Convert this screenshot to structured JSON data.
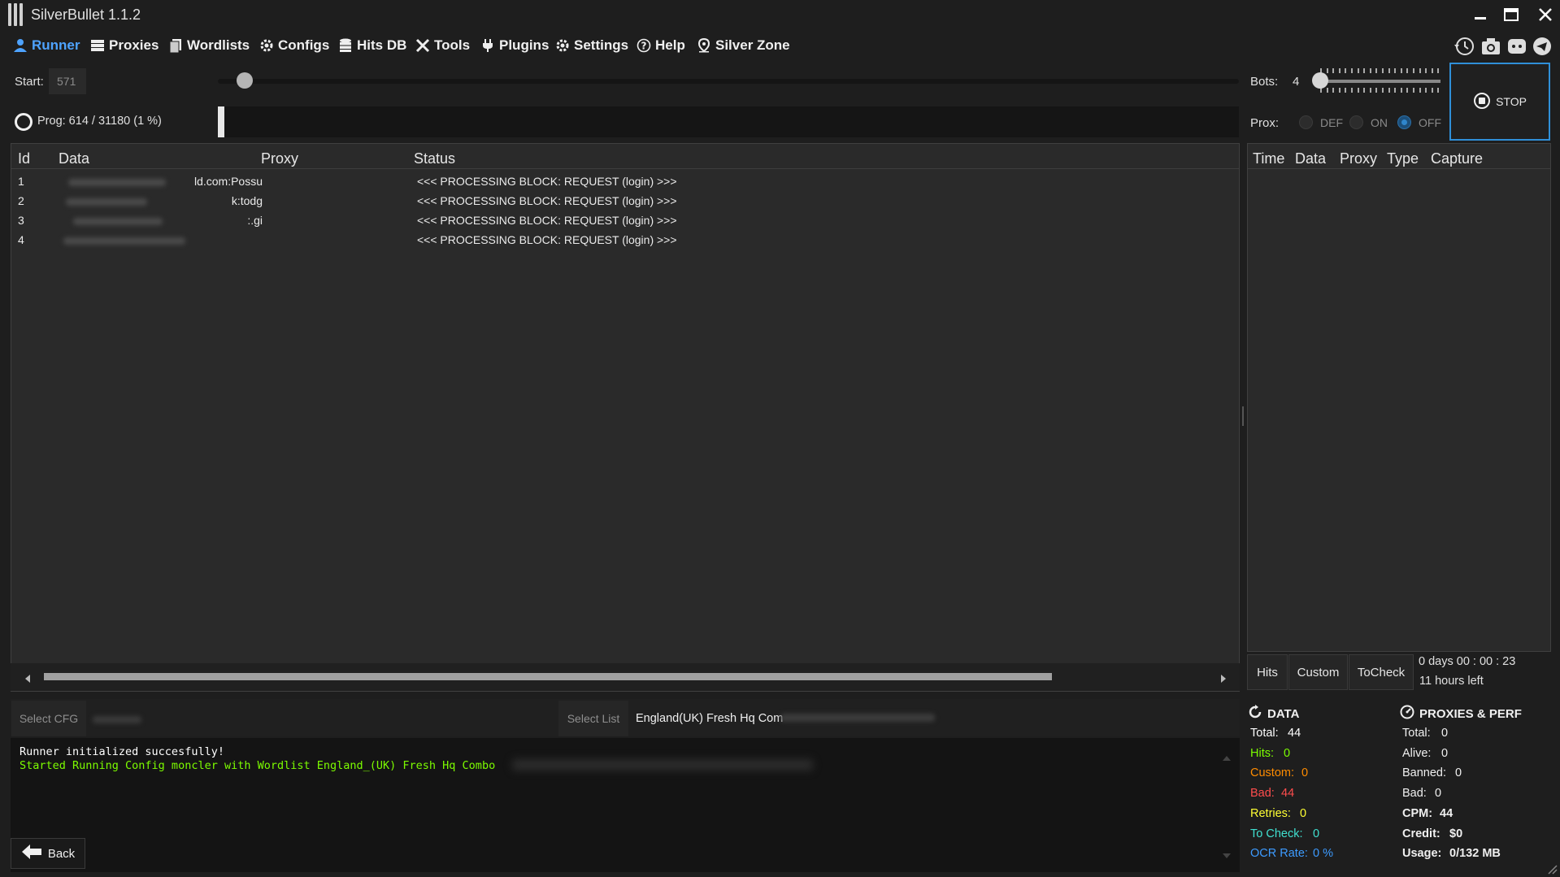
{
  "app": {
    "title": "SilverBullet 1.1.2"
  },
  "nav": {
    "items": [
      {
        "label": "Runner",
        "icon": "user-icon"
      },
      {
        "label": "Proxies",
        "icon": "server-icon"
      },
      {
        "label": "Wordlists",
        "icon": "documents-icon"
      },
      {
        "label": "Configs",
        "icon": "gear-icon"
      },
      {
        "label": "Hits DB",
        "icon": "database-icon"
      },
      {
        "label": "Tools",
        "icon": "tools-icon"
      },
      {
        "label": "Plugins",
        "icon": "plug-icon"
      },
      {
        "label": "Settings",
        "icon": "gear-icon"
      },
      {
        "label": "Help",
        "icon": "question-icon"
      },
      {
        "label": "Silver Zone",
        "icon": "pin-icon"
      }
    ]
  },
  "controls": {
    "start_label": "Start:",
    "start_value": "571",
    "prog_text": "Prog: 614 / 31180  (1 %)",
    "progress_fraction": 0.0197,
    "bots_label": "Bots:",
    "bots_value": "4",
    "prox_label": "Prox:",
    "prox_options": [
      "DEF",
      "ON",
      "OFF"
    ],
    "prox_selected": "OFF",
    "stop_label": "STOP"
  },
  "main_table": {
    "headers": [
      "Id",
      "Data",
      "Proxy",
      "Status"
    ],
    "rows": [
      {
        "id": "1",
        "data": "ld.com:Possu",
        "proxy": "",
        "status": "<<< PROCESSING BLOCK: REQUEST (login) >>>"
      },
      {
        "id": "2",
        "data": "k:todg",
        "proxy": "",
        "status": "<<< PROCESSING BLOCK: REQUEST (login) >>>"
      },
      {
        "id": "3",
        "data": ":.gi",
        "proxy": "",
        "status": "<<< PROCESSING BLOCK: REQUEST (login) >>>"
      },
      {
        "id": "4",
        "data": "",
        "proxy": "",
        "status": "<<< PROCESSING BLOCK: REQUEST (login) >>>"
      }
    ]
  },
  "hits_table": {
    "headers": [
      "Time",
      "Data",
      "Proxy",
      "Type",
      "Capture"
    ]
  },
  "tabs": [
    "Hits",
    "Custom",
    "ToCheck"
  ],
  "timer": {
    "elapsed": "0  days  00 : 00 : 23",
    "remaining": "11 hours left"
  },
  "bottom": {
    "select_cfg_label": "Select CFG",
    "select_list_label": "Select List",
    "wordlist_name": "England(UK) Fresh Hq Com",
    "log": [
      {
        "text": "Runner initialized succesfully!",
        "color": "#ffffff"
      },
      {
        "text": "Started Running Config moncler with Wordlist England_(UK) Fresh Hq Combo",
        "color": "#7cfc00"
      }
    ],
    "back_label": "Back"
  },
  "data_stats": {
    "title": "DATA",
    "items": [
      {
        "label": "Total:",
        "value": "44",
        "color": "#ffffff"
      },
      {
        "label": "Hits:",
        "value": "0",
        "color": "#7cfc00"
      },
      {
        "label": "Custom:",
        "value": "0",
        "color": "#ff8c00"
      },
      {
        "label": "Bad:",
        "value": "44",
        "color": "#ff4d4d"
      },
      {
        "label": "Retries:",
        "value": "0",
        "color": "#ffff33"
      },
      {
        "label": "To Check:",
        "value": "0",
        "color": "#40e0d0"
      },
      {
        "label": "OCR Rate:",
        "value": "0 %",
        "color": "#3d9bff"
      }
    ]
  },
  "proxy_stats": {
    "title": "PROXIES & PERF",
    "items": [
      {
        "label": "Total:",
        "value": "0",
        "bold": false
      },
      {
        "label": "Alive:",
        "value": "0",
        "bold": false
      },
      {
        "label": "Banned:",
        "value": "0",
        "bold": false
      },
      {
        "label": "Bad:",
        "value": "0",
        "bold": false
      },
      {
        "label": "CPM:",
        "value": "44",
        "bold": true
      },
      {
        "label": "Credit:",
        "value": "$0",
        "bold": true
      },
      {
        "label": "Usage:",
        "value": "0/132 MB",
        "bold": true
      }
    ]
  },
  "colors": {
    "accent": "#4ea3ff",
    "stop_border": "#2f8fd8"
  }
}
